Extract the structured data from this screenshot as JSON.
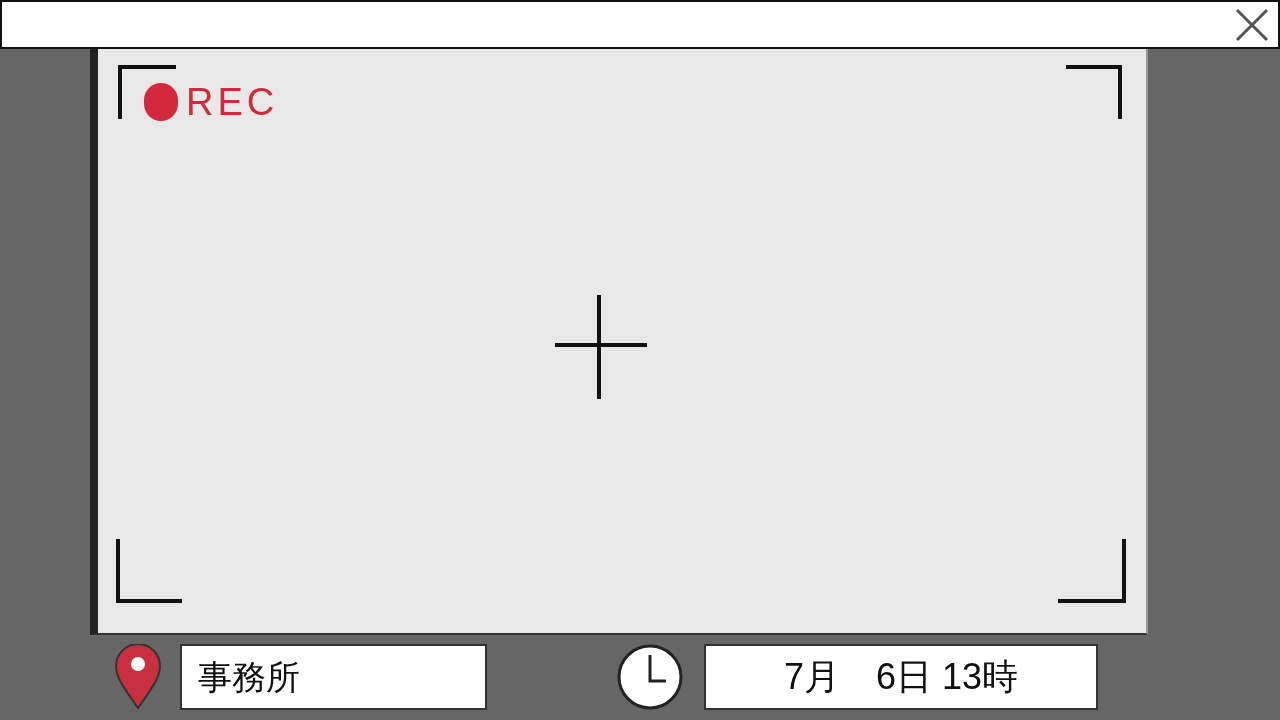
{
  "viewfinder": {
    "recording": true,
    "rec_label": "REC"
  },
  "location": {
    "value": "事務所"
  },
  "datetime": {
    "value": "7月　6日 13時"
  }
}
